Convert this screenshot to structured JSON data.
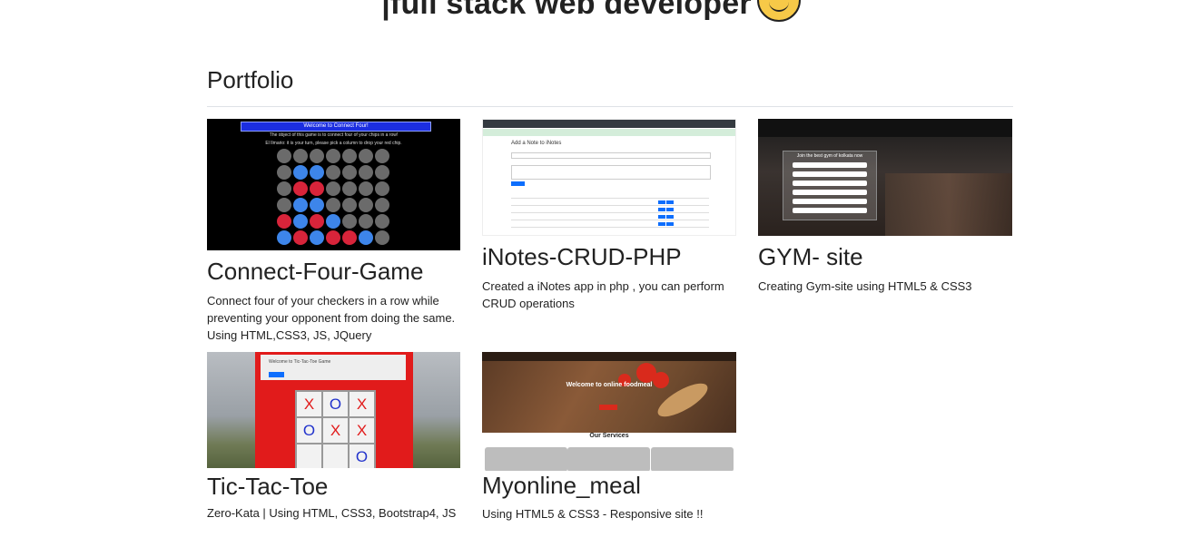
{
  "hero": {
    "text": "|full stack web developer",
    "emoji_icon": "smiling-face-emoji"
  },
  "section": {
    "title": "Portfolio"
  },
  "projects": [
    {
      "title": "Connect-Four-Game",
      "description": "Connect four of your checkers in a row while preventing your opponent from doing the same. Using HTML,CSS3, JS, JQuery",
      "thumb": {
        "banner": "Welcome to Connect Four!",
        "line1": "The object of this game is to connect four of your chips in a row!",
        "line2": "El Ilmario: it is your turn, please pick a column to drop your red chip."
      }
    },
    {
      "title": "iNotes-CRUD-PHP",
      "description": "Created a iNotes app in php , you can perform CRUD operations",
      "thumb": {
        "heading": "Add a Note to iNotes"
      }
    },
    {
      "title": "GYM- site",
      "description": "Creating Gym-site using HTML5 & CSS3",
      "thumb": {
        "heading": "Join the best gym of kolkata now"
      }
    },
    {
      "title": "Tic-Tac-Toe",
      "description": "Zero-Kata | Using HTML, CSS3, Bootstrap4, JS",
      "thumb": {
        "heading": "Welcome to Tic-Tac-Toe Game",
        "cells": [
          "X",
          "O",
          "X",
          "O",
          "X",
          "X",
          "",
          "",
          "O"
        ]
      }
    },
    {
      "title": "Myonline_meal",
      "description": "Using HTML5 & CSS3 - Responsive site !!",
      "thumb": {
        "heading": "Welcome to online foodmeal",
        "services": "Our Services"
      }
    }
  ],
  "colors": {
    "connect_blue": "#3d85ea",
    "connect_red": "#d8243a",
    "ttt_red": "#e11b1b"
  }
}
